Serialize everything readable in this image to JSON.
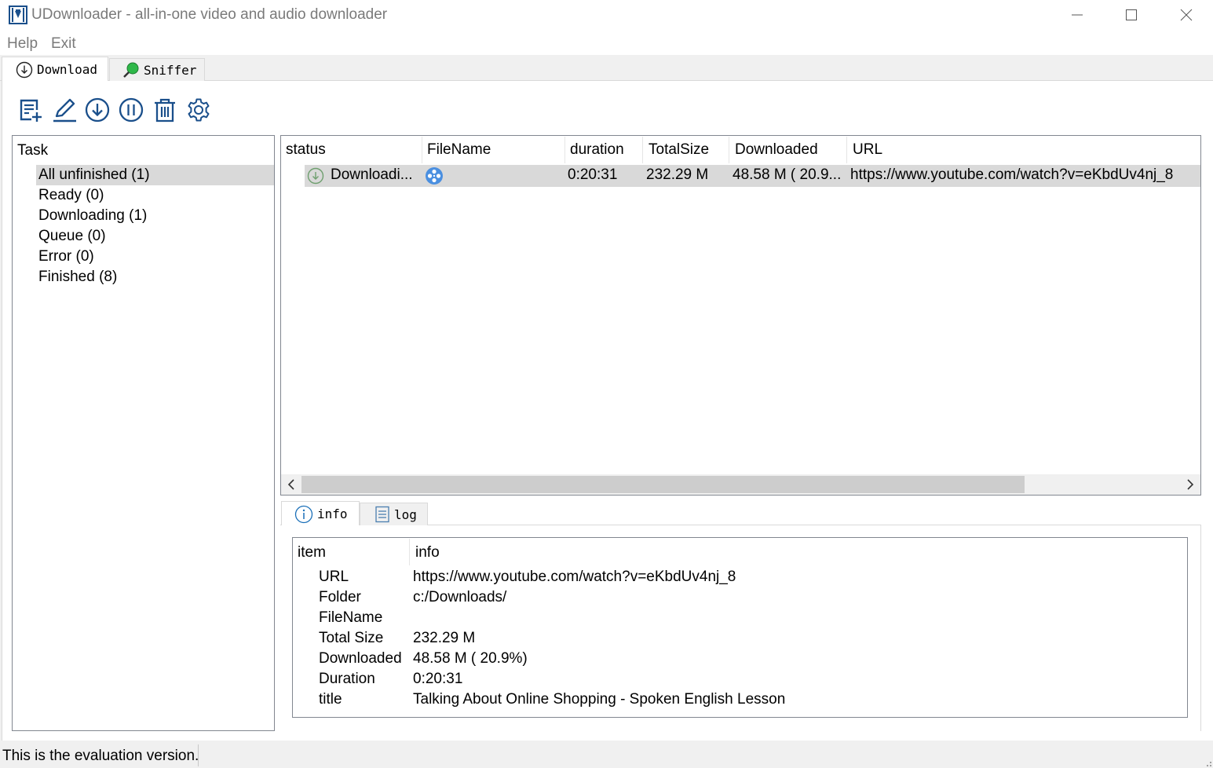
{
  "window": {
    "title": "UDownloader - all-in-one video and audio downloader"
  },
  "menu": {
    "help": "Help",
    "exit": "Exit"
  },
  "tabs": [
    {
      "label": "Download",
      "icon": "download-circle-icon",
      "active": true
    },
    {
      "label": "Sniffer",
      "icon": "sniffer-magnifier-icon",
      "active": false
    }
  ],
  "toolbar": {
    "icons": [
      "add-task-icon",
      "edit-icon",
      "download-icon",
      "pause-icon",
      "delete-icon",
      "settings-gear-icon"
    ]
  },
  "tasks": {
    "header": "Task",
    "items": [
      {
        "label": "All unfinished (1)",
        "selected": true
      },
      {
        "label": "Ready (0)"
      },
      {
        "label": "Downloading (1)"
      },
      {
        "label": "Queue (0)"
      },
      {
        "label": "Error (0)"
      },
      {
        "label": "Finished (8)"
      }
    ]
  },
  "table": {
    "columns": [
      "status",
      "FileName",
      "duration",
      "TotalSize",
      "Downloaded",
      "URL"
    ],
    "rows": [
      {
        "status": "Downloadi...",
        "filename": "",
        "duration": "0:20:31",
        "total_size": "232.29 M",
        "downloaded": "48.58 M ( 20.9...",
        "url": "https://www.youtube.com/watch?v=eKbdUv4nj_8"
      }
    ]
  },
  "bottom_tabs": [
    {
      "label": "info",
      "icon": "info-icon",
      "active": true
    },
    {
      "label": "log",
      "icon": "log-document-icon",
      "active": false
    }
  ],
  "info": {
    "headers": {
      "item": "item",
      "info": "info"
    },
    "rows": [
      {
        "key": "URL",
        "value": "https://www.youtube.com/watch?v=eKbdUv4nj_8"
      },
      {
        "key": "Folder",
        "value": "c:/Downloads/"
      },
      {
        "key": "FileName",
        "value": ""
      },
      {
        "key": "Total Size",
        "value": "232.29 M"
      },
      {
        "key": "Downloaded",
        "value": "48.58 M ( 20.9%)"
      },
      {
        "key": "Duration",
        "value": "0:20:31"
      },
      {
        "key": "title",
        "value": "Talking About Online Shopping - Spoken English Lesson"
      }
    ]
  },
  "status_bar": {
    "text": "This is the evaluation version."
  },
  "colors": {
    "accent": "#1a4f8b",
    "selection": "#d9d9d9",
    "sniffer_green": "#2fb84a",
    "filetype_blue": "#4a8fe0"
  }
}
